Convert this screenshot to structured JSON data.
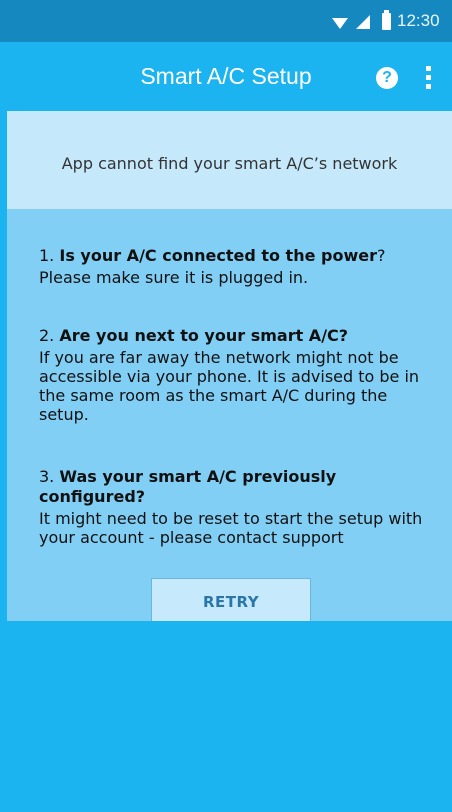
{
  "status_bar": {
    "time": "12:30",
    "icons": [
      "wifi-icon",
      "signal-icon",
      "battery-icon"
    ]
  },
  "app_bar": {
    "title": "Smart A/C Setup",
    "help_icon_glyph": "?",
    "icons": [
      "help-icon",
      "more-vert-icon"
    ]
  },
  "banner": {
    "message": "App cannot find your smart A/C’s network"
  },
  "checklist": [
    {
      "number": "1.",
      "question": "Is your A/C connected to the power",
      "question_suffix": "?",
      "detail": "Please make sure it is plugged in."
    },
    {
      "number": "2.",
      "question": "Are you next to your smart A/C?",
      "question_suffix": "",
      "detail": "If you are far away the network might not be accessible via your phone. It is advised to be in the same room as the smart A/C during the setup."
    },
    {
      "number": "3.",
      "question": "Was your smart A/C previously configured?",
      "question_suffix": "",
      "detail": "It might need to be reset to start the setup with your account - please contact support"
    }
  ],
  "actions": {
    "retry_label": "RETRY"
  },
  "colors": {
    "status_bar": "#1688c0",
    "primary": "#1bb4f0",
    "banner": "#c5e9fb",
    "panel": "#82cff6",
    "button": "#c6eafc",
    "button_text": "#2b76a6"
  }
}
